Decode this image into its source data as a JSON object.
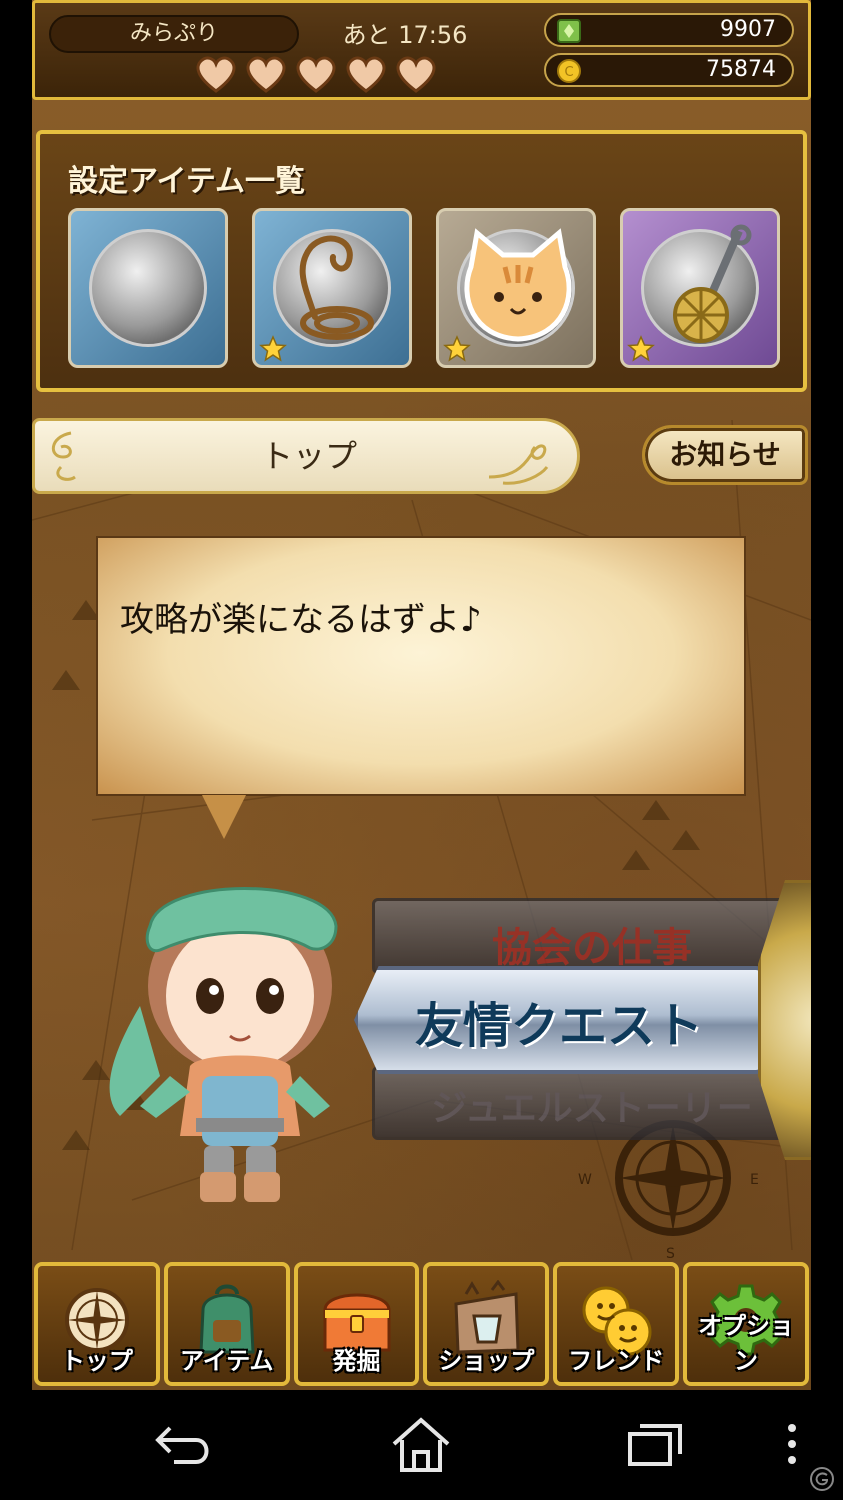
{
  "status": {
    "player_name": "みらぷり",
    "timer": "あと 17:56",
    "hearts": 5,
    "gems": "9907",
    "coins": "75874"
  },
  "items_panel": {
    "title": "設定アイテム一覧",
    "slots": [
      {
        "name": "empty-slot",
        "frame": "blue",
        "starred": false
      },
      {
        "name": "rope-item",
        "frame": "blue",
        "starred": true
      },
      {
        "name": "cat-face-item",
        "frame": "gray",
        "starred": true
      },
      {
        "name": "charm-item",
        "frame": "purple",
        "starred": true
      }
    ]
  },
  "banner": {
    "title": "トップ",
    "news_button": "お知らせ"
  },
  "speech": {
    "text": "攻略が楽になるはずよ♪"
  },
  "mode_wheel": {
    "above": "協会の仕事",
    "selected": "友情クエスト",
    "below": "ジュエルストーリー"
  },
  "compass_labels": {
    "west": "W",
    "east": "E",
    "south": "S"
  },
  "nav": [
    {
      "label": "トップ",
      "icon": "compass-icon"
    },
    {
      "label": "アイテム",
      "icon": "backpack-icon"
    },
    {
      "label": "発掘",
      "icon": "treasure-chest-icon"
    },
    {
      "label": "ショップ",
      "icon": "shop-icon"
    },
    {
      "label": "フレンド",
      "icon": "friends-icon"
    },
    {
      "label": "オプション",
      "icon": "gear-icon"
    }
  ],
  "colors": {
    "gold_border": "#e2b93b",
    "selected_mode_text": "#0f3a5a",
    "dim_mode_text": "#a12828"
  }
}
